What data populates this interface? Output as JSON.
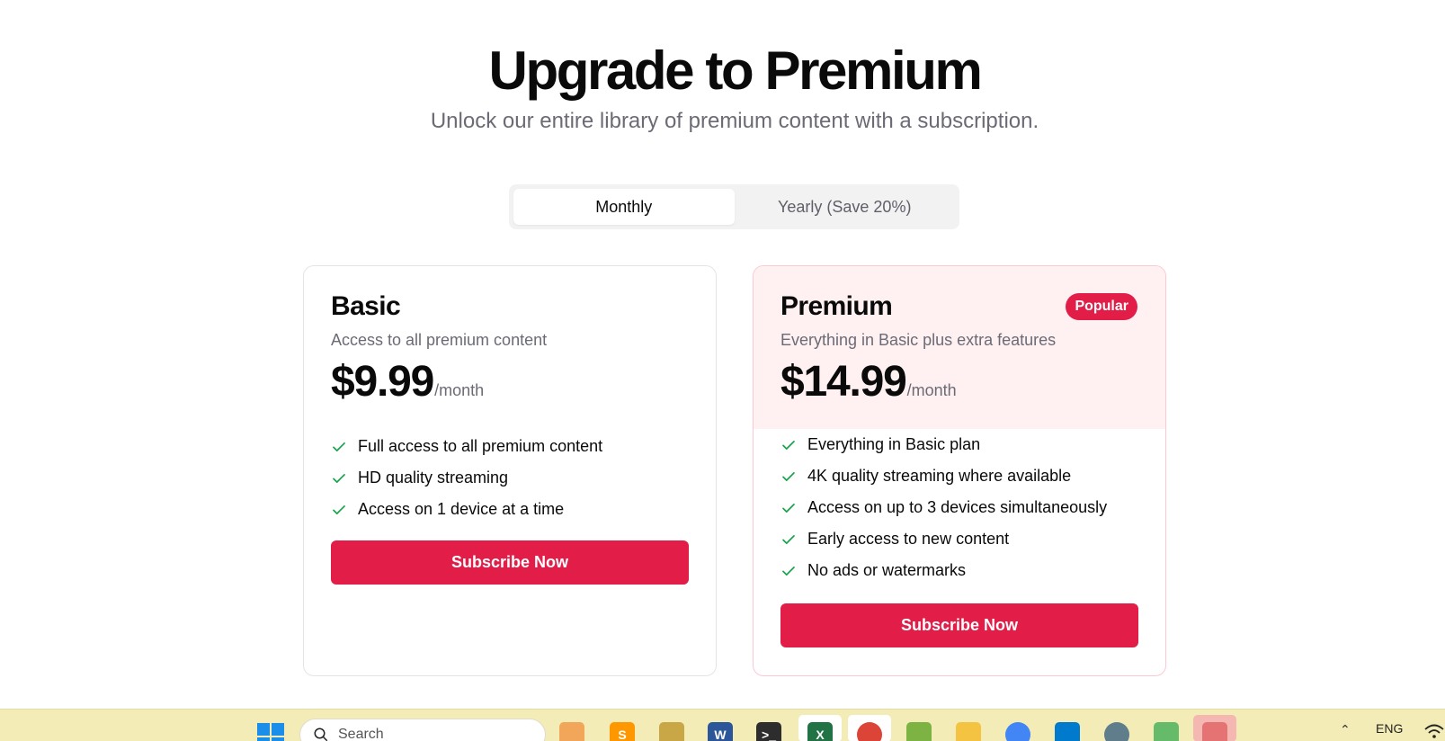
{
  "header": {
    "title": "Upgrade to Premium",
    "subtitle": "Unlock our entire library of premium content with a subscription."
  },
  "billing_toggle": {
    "options": [
      "Monthly",
      "Yearly (Save 20%)"
    ],
    "selected": "Monthly"
  },
  "plans": [
    {
      "name": "Basic",
      "description": "Access to all premium content",
      "price": "$9.99",
      "period": "/month",
      "features": [
        "Full access to all premium content",
        "HD quality streaming",
        "Access on 1 device at a time"
      ],
      "cta": "Subscribe Now"
    },
    {
      "name": "Premium",
      "badge": "Popular",
      "description": "Everything in Basic plus extra features",
      "price": "$14.99",
      "period": "/month",
      "features": [
        "Everything in Basic plan",
        "4K quality streaming where available",
        "Access on up to 3 devices simultaneously",
        "Early access to new content",
        "No ads or watermarks"
      ],
      "cta": "Subscribe Now"
    }
  ],
  "colors": {
    "accent": "#e11d48",
    "premium_tint": "#fff0f1",
    "check": "#16a34a"
  },
  "taskbar": {
    "search_placeholder": "Search",
    "language": "ENG",
    "apps": [
      "start-icon",
      "search-icon",
      "copilot-icon",
      "sublime-text-icon",
      "paint-icon",
      "word-icon",
      "terminal-icon",
      "excel-icon",
      "chrome-icon",
      "notepad-plus-icon",
      "file-explorer-icon",
      "chrome-profile-icon",
      "vscode-icon",
      "settings-icon",
      "tools-icon",
      "app-icon"
    ]
  }
}
